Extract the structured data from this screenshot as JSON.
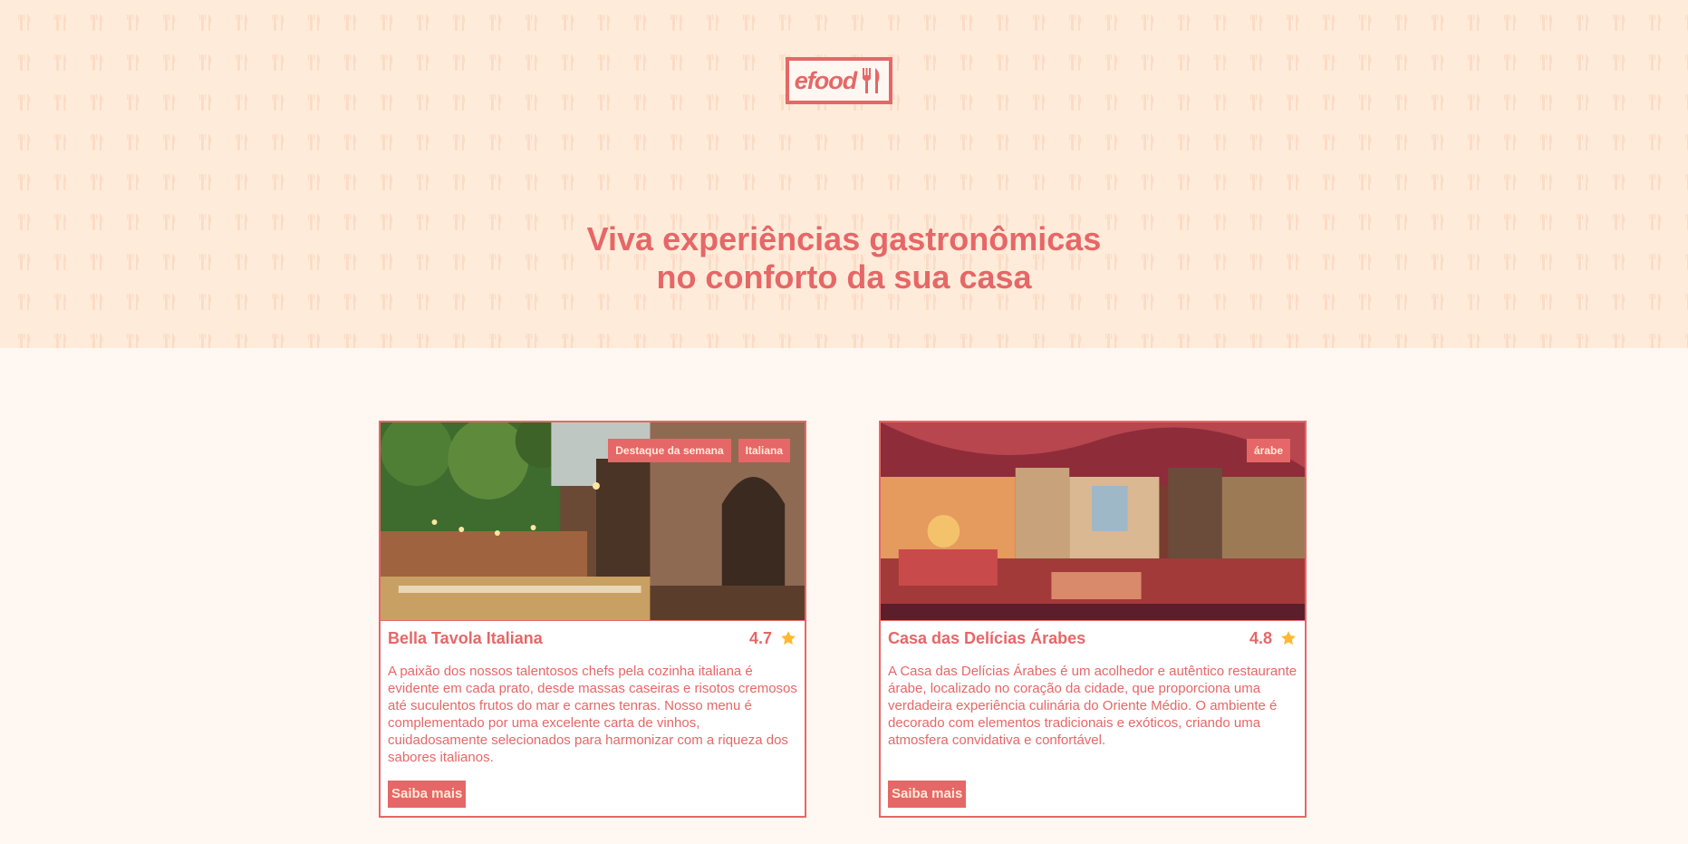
{
  "brand": {
    "logo_text": "efood",
    "accent": "#E66767",
    "cream": "#FFEBD9"
  },
  "hero": {
    "headline_line1": "Viva experiências gastronômicas",
    "headline_line2": "no conforto da sua casa"
  },
  "restaurants": [
    {
      "name": "Bella Tavola Italiana",
      "rating": "4.7",
      "tags": [
        "Destaque da semana",
        "Italiana"
      ],
      "description": "A paixão dos nossos talentosos chefs pela cozinha italiana é evidente em cada prato, desde massas caseiras e risotos cremosos até suculentos frutos do mar e carnes tenras. Nosso menu é complementado por uma excelente carta de vinhos, cuidadosamente selecionados para harmonizar com a riqueza dos sabores italianos.",
      "button_label": "Saiba mais",
      "image_icon": "restaurant-photo"
    },
    {
      "name": "Casa das Delícias Árabes",
      "rating": "4.8",
      "tags": [
        "árabe"
      ],
      "description": "A Casa das Delícias Árabes é um acolhedor e autêntico restaurante árabe, localizado no coração da cidade, que proporciona uma verdadeira experiência culinária do Oriente Médio. O ambiente é decorado com elementos tradicionais e exóticos, criando uma atmosfera convidativa e confortável.",
      "button_label": "Saiba mais",
      "image_icon": "restaurant-photo"
    }
  ],
  "icons": {
    "logo": "fork-knife-icon",
    "rating": "star-icon"
  },
  "star_color": "#FFB930"
}
